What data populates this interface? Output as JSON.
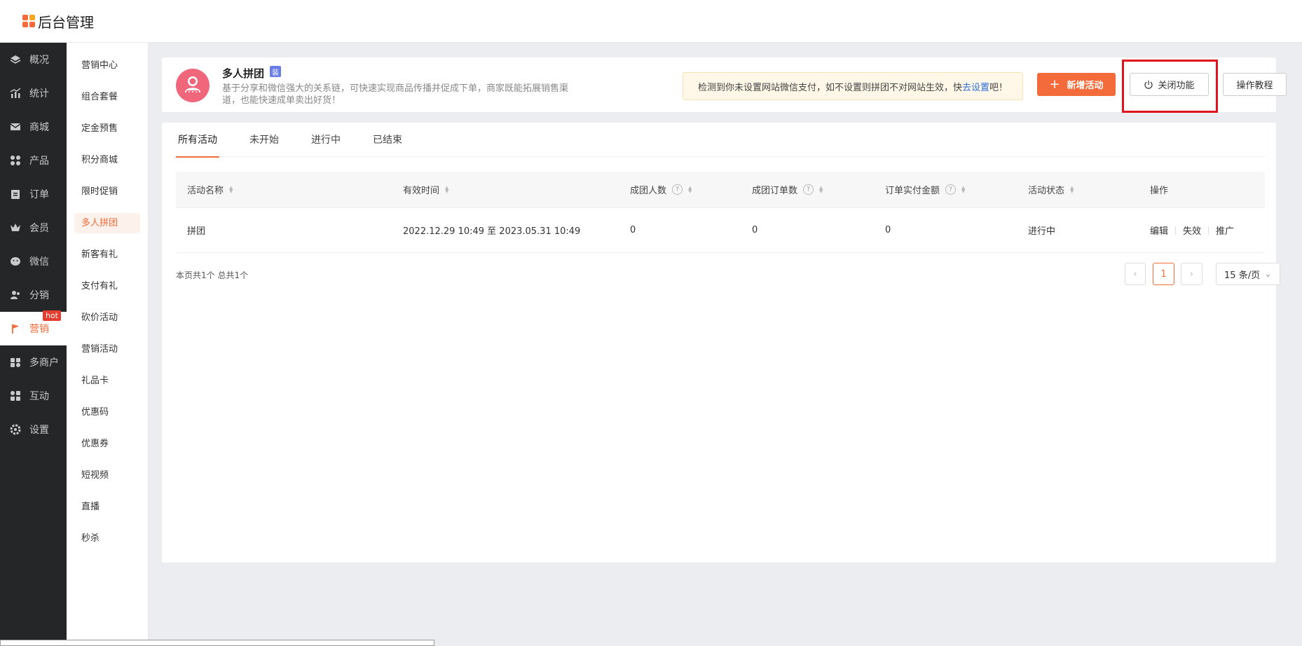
{
  "app": {
    "title": "后台管理"
  },
  "sidebar": {
    "items": [
      {
        "label": "概况",
        "icon": "layers-icon"
      },
      {
        "label": "统计",
        "icon": "stats-icon"
      },
      {
        "label": "商城",
        "icon": "mail-icon"
      },
      {
        "label": "产品",
        "icon": "grid-icon"
      },
      {
        "label": "订单",
        "icon": "clipboard-icon"
      },
      {
        "label": "会员",
        "icon": "crown-icon"
      },
      {
        "label": "微信",
        "icon": "wechat-icon"
      },
      {
        "label": "分销",
        "icon": "users-icon"
      },
      {
        "label": "营销",
        "icon": "flag-icon",
        "badge": "hot",
        "active": true
      },
      {
        "label": "多商户",
        "icon": "store-icon"
      },
      {
        "label": "互动",
        "icon": "apps-icon"
      },
      {
        "label": "设置",
        "icon": "gear-icon"
      }
    ]
  },
  "subnav": {
    "items": [
      {
        "label": "营销中心"
      },
      {
        "label": "组合套餐"
      },
      {
        "label": "定金预售"
      },
      {
        "label": "积分商城"
      },
      {
        "label": "限时促销"
      },
      {
        "label": "多人拼团",
        "active": true
      },
      {
        "label": "新客有礼"
      },
      {
        "label": "支付有礼"
      },
      {
        "label": "砍价活动"
      },
      {
        "label": "营销活动"
      },
      {
        "label": "礼品卡"
      },
      {
        "label": "优惠码"
      },
      {
        "label": "优惠券"
      },
      {
        "label": "短视频"
      },
      {
        "label": "直播"
      },
      {
        "label": "秒杀"
      }
    ]
  },
  "module": {
    "title": "多人拼团",
    "badge": "装",
    "desc": "基于分享和微信强大的关系链，可快速实现商品传播并促成下单，商家既能拓展销售渠道，也能快速成单卖出好货！",
    "notice_text": "检测到你未设置网站微信支付，如不设置则拼团不对网站生效，快 ",
    "notice_link": "去设置",
    "notice_tail": "吧！",
    "add_button": "新增活动",
    "close_button": "关闭功能",
    "tutorial_button": "操作教程"
  },
  "tabs": [
    {
      "label": "所有活动",
      "active": true
    },
    {
      "label": "未开始"
    },
    {
      "label": "进行中"
    },
    {
      "label": "已结束"
    }
  ],
  "table": {
    "columns": [
      {
        "label": "活动名称",
        "sortable": true,
        "help": false
      },
      {
        "label": "有效时间",
        "sortable": true,
        "help": false
      },
      {
        "label": "成团人数",
        "sortable": true,
        "help": true
      },
      {
        "label": "成团订单数",
        "sortable": true,
        "help": true
      },
      {
        "label": "订单实付金额",
        "sortable": true,
        "help": true
      },
      {
        "label": "活动状态",
        "sortable": true,
        "help": false
      },
      {
        "label": "操作",
        "sortable": false,
        "help": false
      }
    ],
    "rows": [
      {
        "name": "拼团",
        "time": "2022.12.29 10:49 至 2023.05.31 10:49",
        "members": "0",
        "orders": "0",
        "amount": "0",
        "status": "进行中",
        "actions": [
          "编辑",
          "失效",
          "推广"
        ]
      }
    ]
  },
  "pagination": {
    "summary": "本页共1个 总共1个",
    "current": "1",
    "page_size": "15 条/页",
    "prev": "‹",
    "next": "›",
    "size_arrow": "⌄"
  },
  "colors": {
    "accent": "#f36b3a",
    "sidebar_bg": "#242628",
    "highlight": "#e0141e",
    "link": "#2f6fd8"
  }
}
